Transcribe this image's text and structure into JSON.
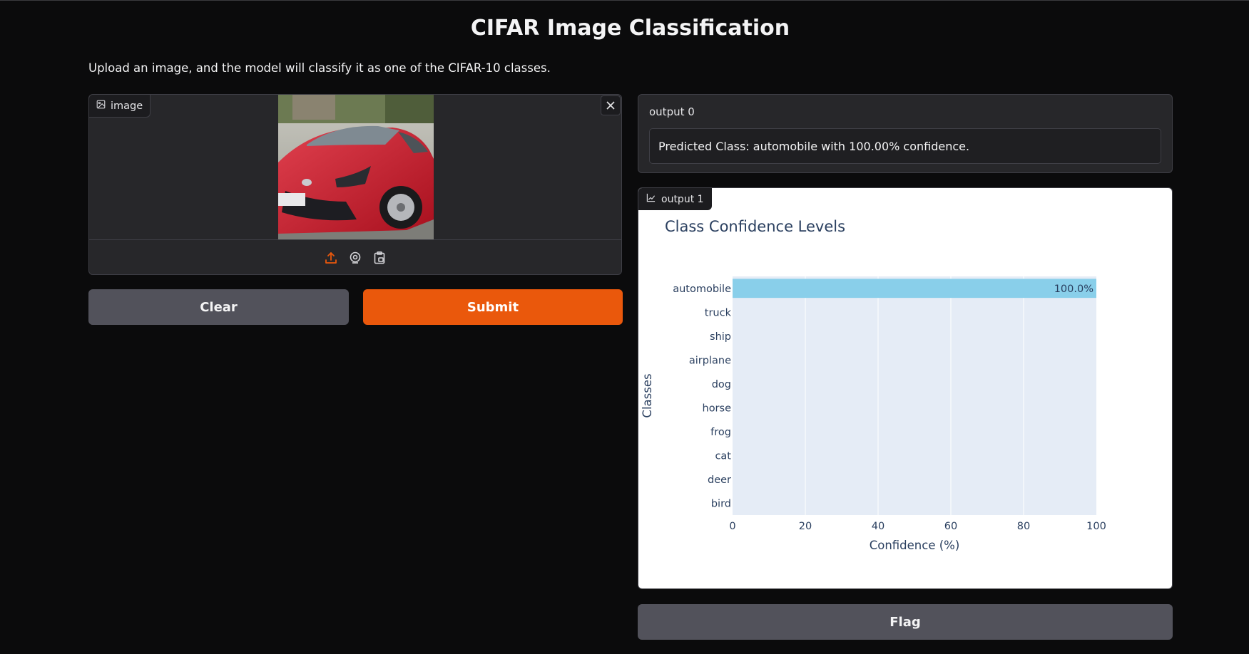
{
  "page": {
    "title": "CIFAR Image Classification",
    "description": "Upload an image, and the model will classify it as one of the CIFAR-10 classes."
  },
  "image_input": {
    "label": "image",
    "clear_icon": "close-icon",
    "source_icons": [
      "upload-icon",
      "webcam-icon",
      "clipboard-icon"
    ],
    "accent_color": "#ea580c"
  },
  "buttons": {
    "clear_label": "Clear",
    "submit_label": "Submit",
    "flag_label": "Flag"
  },
  "output0": {
    "label": "output 0",
    "value": "Predicted Class: automobile with 100.00% confidence."
  },
  "output1": {
    "label": "output 1",
    "icon": "chart-icon"
  },
  "chart_data": {
    "type": "bar",
    "orientation": "horizontal",
    "title": "Class Confidence Levels",
    "xlabel": "Confidence (%)",
    "ylabel": "Classes",
    "categories": [
      "automobile",
      "truck",
      "ship",
      "airplane",
      "dog",
      "horse",
      "frog",
      "cat",
      "deer",
      "bird"
    ],
    "values": [
      100.0,
      0,
      0,
      0,
      0,
      0,
      0,
      0,
      0,
      0
    ],
    "data_labels": [
      "100.0%",
      "",
      "",
      "",
      "",
      "",
      "",
      "",
      "",
      ""
    ],
    "xlim": [
      0,
      100
    ],
    "xticks": [
      "0",
      "20",
      "40",
      "60",
      "80",
      "100"
    ],
    "bar_color": "#89cfea",
    "plot_bg": "#e5ecf6",
    "grid": true
  }
}
